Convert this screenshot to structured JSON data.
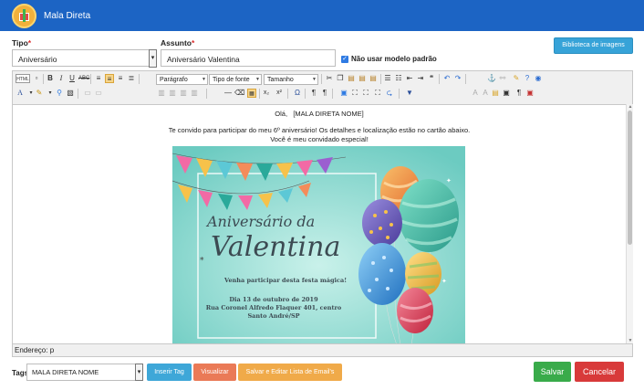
{
  "app": {
    "title": "Mala Direta"
  },
  "form": {
    "tipo_label": "Tipo",
    "tipo_value": "Aniversário",
    "assunto_label": "Assunto",
    "assunto_value": "Aniversário Valentina",
    "required_mark": "*",
    "no_default_label": "Não usar modelo padrão",
    "no_default_checked": true,
    "library_button": "Biblioteca de imagens"
  },
  "toolbar": {
    "html_label": "HTML",
    "paragraph_select": "Parágrafo",
    "font_select": "Tipo de fonte",
    "size_select": "Tamanho"
  },
  "editor": {
    "greeting": "Olá,",
    "placeholder_tag": "[MALA DIRETA NOME]",
    "body_line1": "Te convido para participar do meu 6º aniversário! Os detalhes e localização estão no cartão abaixo.",
    "body_line2": "Você é meu convidado especial!",
    "status": "Endereço: p"
  },
  "invite": {
    "title_line1": "Aniversário da",
    "title_line2": "Valentina",
    "tagline": "Venha participar desta festa mágica!",
    "date": "Dia 13 de outubro de 2019",
    "address": "Rua Coronel Alfredo Flaquer 401, centro",
    "city": "Santo André/SP"
  },
  "footer": {
    "tags_label": "Tags",
    "tags_value": "MALA DIRETA NOME",
    "insert_tag": "Inserir Tag",
    "view": "Visualizar",
    "save_edit_list": "Salvar e Editar Lista de Email's",
    "save": "Salvar",
    "cancel": "Cancelar"
  },
  "colors": {
    "header": "#1c64c4",
    "info": "#37a3d8",
    "orange": "#ea7a57",
    "warning": "#f0aa49",
    "success": "#39ab4a",
    "danger": "#d83a3a"
  }
}
